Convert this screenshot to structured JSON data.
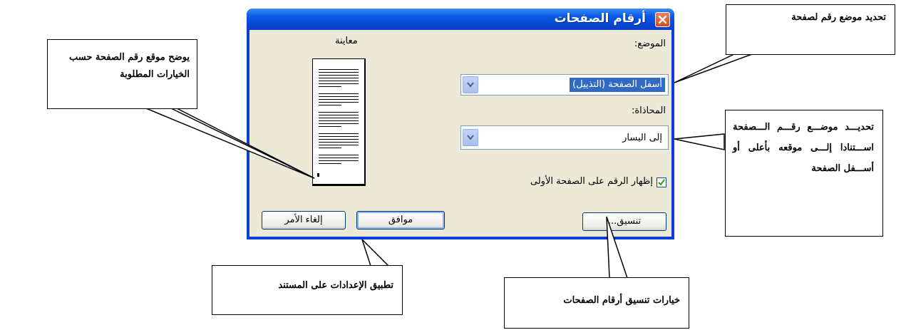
{
  "dialog": {
    "title": "أرقام الصفحات",
    "close_icon": "close-icon",
    "position_label": "الموضع:",
    "position_value": "أسفل الصفحة (التذييل)",
    "alignment_label": "المحاذاة:",
    "alignment_value": "إلى اليسار",
    "first_page_label": "إظهار الرقم على الصفحة الأولى",
    "first_page_checked": true,
    "preview_label": "معاينة",
    "format_button": "تنسيق...",
    "ok_button": "موافق",
    "cancel_button": "إلغاء الأمر"
  },
  "callouts": {
    "position": "تحديد موضع رقم لصفحة",
    "alignment": "تحديـــد موضـــع رقـــم الـــصفحة اســـتنادا إلـــى موقعه بأعلى أو أســـفل الصفحة",
    "preview": "يوضح موقع رقم الصفحة حسب الخيارات المطلوبة",
    "ok": "تطبيق الإعدادات على المستند",
    "format": "خيارات تنسيق أرقام الصفحات"
  },
  "colors": {
    "title_bar": "#0a5be6",
    "dialog_face": "#ece9d8",
    "selection": "#316ac5",
    "close_button": "#d44b1c"
  }
}
